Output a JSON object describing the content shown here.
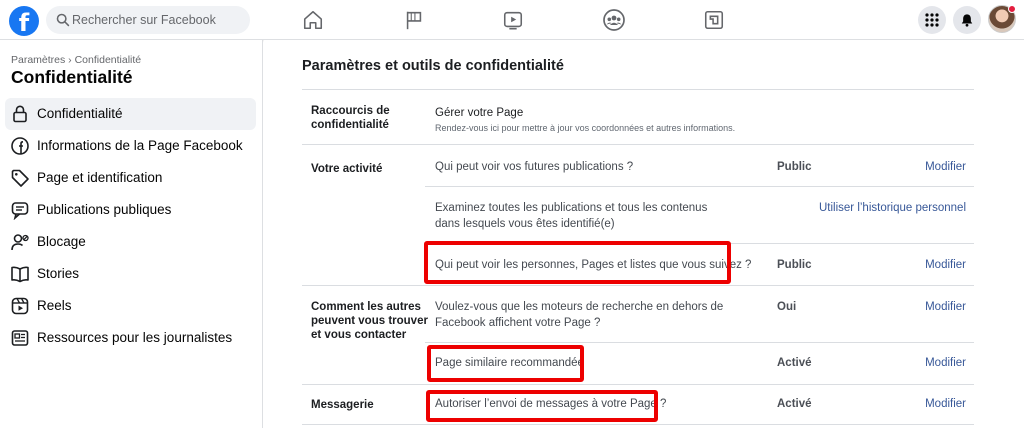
{
  "topbar": {
    "logo_letter": "f",
    "search_placeholder": "Rechercher sur Facebook",
    "nav_icons": [
      "home-icon",
      "flag-icon",
      "video-icon",
      "groups-icon",
      "gaming-icon"
    ],
    "right_icons": [
      "menu-grid-icon",
      "notifications-bell-icon",
      "profile-avatar"
    ]
  },
  "sidebar": {
    "breadcrumb": "Paramètres › Confidentialité",
    "title": "Confidentialité",
    "items": [
      {
        "label": "Confidentialité",
        "icon": "lock-icon",
        "active": true
      },
      {
        "label": "Informations de la Page Facebook",
        "icon": "facebook-icon",
        "active": false
      },
      {
        "label": "Page et identification",
        "icon": "tag-icon",
        "active": false
      },
      {
        "label": "Publications publiques",
        "icon": "public-posts-icon",
        "active": false
      },
      {
        "label": "Blocage",
        "icon": "block-user-icon",
        "active": false
      },
      {
        "label": "Stories",
        "icon": "book-icon",
        "active": false
      },
      {
        "label": "Reels",
        "icon": "reels-icon",
        "active": false
      },
      {
        "label": "Ressources pour les journalistes",
        "icon": "news-icon",
        "active": false
      }
    ]
  },
  "main": {
    "title": "Paramètres et outils de confidentialité",
    "sections": {
      "raccourcis": {
        "label": "Raccourcis de confidentialité",
        "row_title": "Gérer votre Page",
        "row_sub": "Rendez-vous ici pour mettre à jour vos coordonnées et autres informations."
      },
      "activite": {
        "label": "Votre activité",
        "row1": {
          "text": "Qui peut voir vos futures publications ?",
          "status": "Public",
          "action": "Modifier"
        },
        "row2": {
          "text": "Examinez toutes les publications et tous les contenus dans lesquels vous êtes identifié(e)",
          "action": "Utiliser l’historique personnel"
        },
        "row3": {
          "text": "Qui peut voir les personnes, Pages et listes que vous suivez ?",
          "status": "Public",
          "action": "Modifier"
        }
      },
      "trouver": {
        "label": "Comment les autres peuvent vous trouver et vous contacter",
        "row1": {
          "text": "Voulez-vous que les moteurs de recherche en dehors de Facebook affichent votre Page ?",
          "status": "Oui",
          "action": "Modifier"
        },
        "row2": {
          "text": "Page similaire recommandée",
          "status": "Activé",
          "action": "Modifier"
        }
      },
      "messagerie": {
        "label": "Messagerie",
        "row1": {
          "text": "Autoriser l’envoi de messages à votre Page ?",
          "status": "Activé",
          "action": "Modifier"
        }
      }
    }
  },
  "colors": {
    "brand": "#1877f2",
    "link": "#385898",
    "highlight": "#ed0000"
  }
}
